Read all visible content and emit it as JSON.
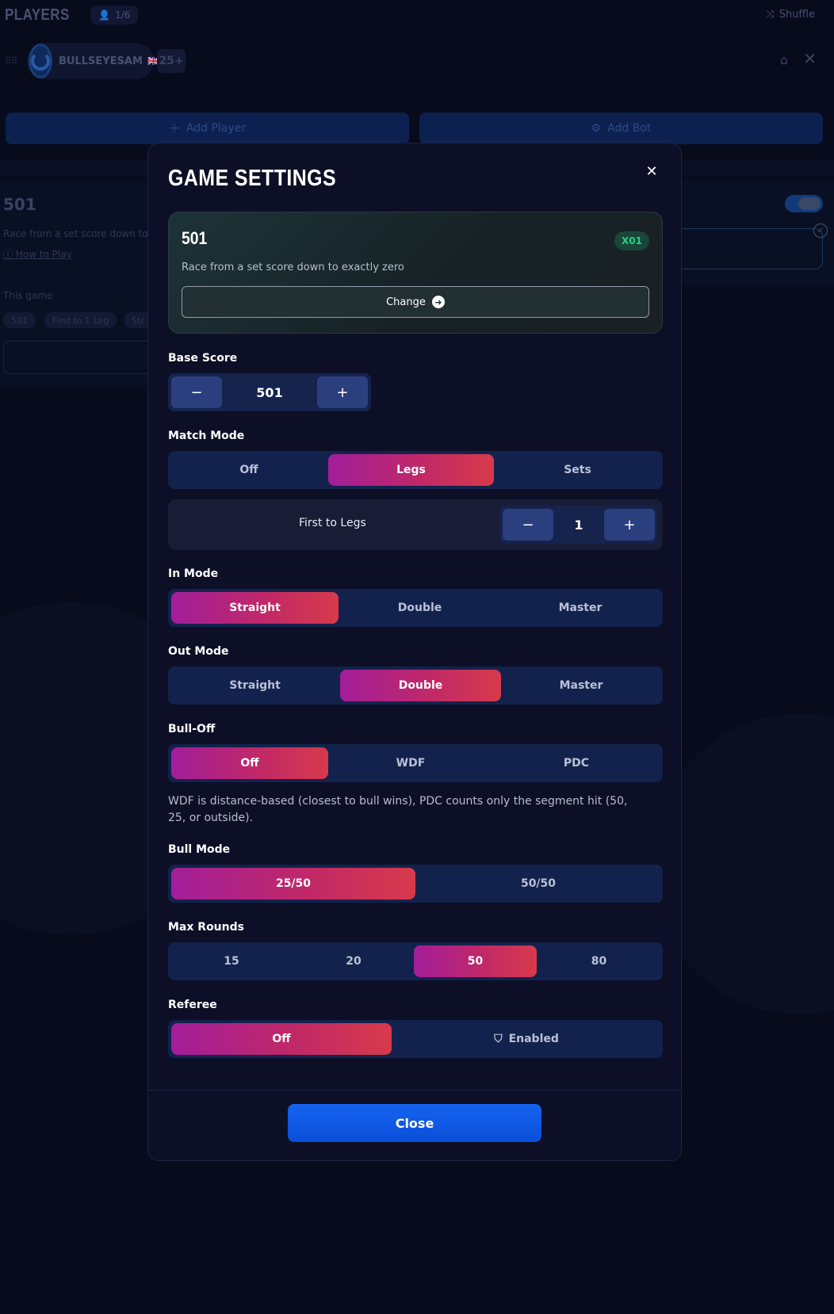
{
  "header": {
    "title": "PLAYERS",
    "player_count": "1/6",
    "shuffle_label": "Shuffle"
  },
  "player": {
    "name": "BULLSEYESAM",
    "flag": "🇬🇧",
    "age_label": "25+"
  },
  "actions": {
    "add_player": "Add Player",
    "add_bot": "Add Bot"
  },
  "background_game": {
    "title": "501",
    "description": "Race from a set score down to",
    "how_to_play": "How to Play",
    "this_game_label": "This game",
    "chips": [
      "501",
      "First to 1 Leg",
      "Str"
    ]
  },
  "modal": {
    "title": "GAME SETTINGS",
    "close_icon": "close-icon",
    "game_card": {
      "name": "501",
      "badge": "X01",
      "description": "Race from a set score down to exactly zero",
      "change_label": "Change"
    },
    "base_score": {
      "label": "Base Score",
      "value": "501"
    },
    "match_mode": {
      "label": "Match Mode",
      "options": [
        "Off",
        "Legs",
        "Sets"
      ],
      "selected": "Legs",
      "first_to_label": "First to Legs",
      "first_to_value": "1"
    },
    "in_mode": {
      "label": "In Mode",
      "options": [
        "Straight",
        "Double",
        "Master"
      ],
      "selected": "Straight"
    },
    "out_mode": {
      "label": "Out Mode",
      "options": [
        "Straight",
        "Double",
        "Master"
      ],
      "selected": "Double"
    },
    "bull_off": {
      "label": "Bull-Off",
      "options": [
        "Off",
        "WDF",
        "PDC"
      ],
      "selected": "Off",
      "note": "WDF is distance-based (closest to bull wins), PDC counts only the segment hit (50, 25, or outside)."
    },
    "bull_mode": {
      "label": "Bull Mode",
      "options": [
        "25/50",
        "50/50"
      ],
      "selected": "25/50"
    },
    "max_rounds": {
      "label": "Max Rounds",
      "options": [
        "15",
        "20",
        "50",
        "80"
      ],
      "selected": "50"
    },
    "referee": {
      "label": "Referee",
      "options": [
        "Off",
        "Enabled"
      ],
      "selected": "Off"
    },
    "close_label": "Close"
  },
  "colors": {
    "accent_gradient_start": "#a21e9a",
    "accent_gradient_end": "#d73a4a",
    "primary_button": "#1563f0",
    "badge_green": "#2dcc88",
    "segment_bg": "#13224c"
  }
}
